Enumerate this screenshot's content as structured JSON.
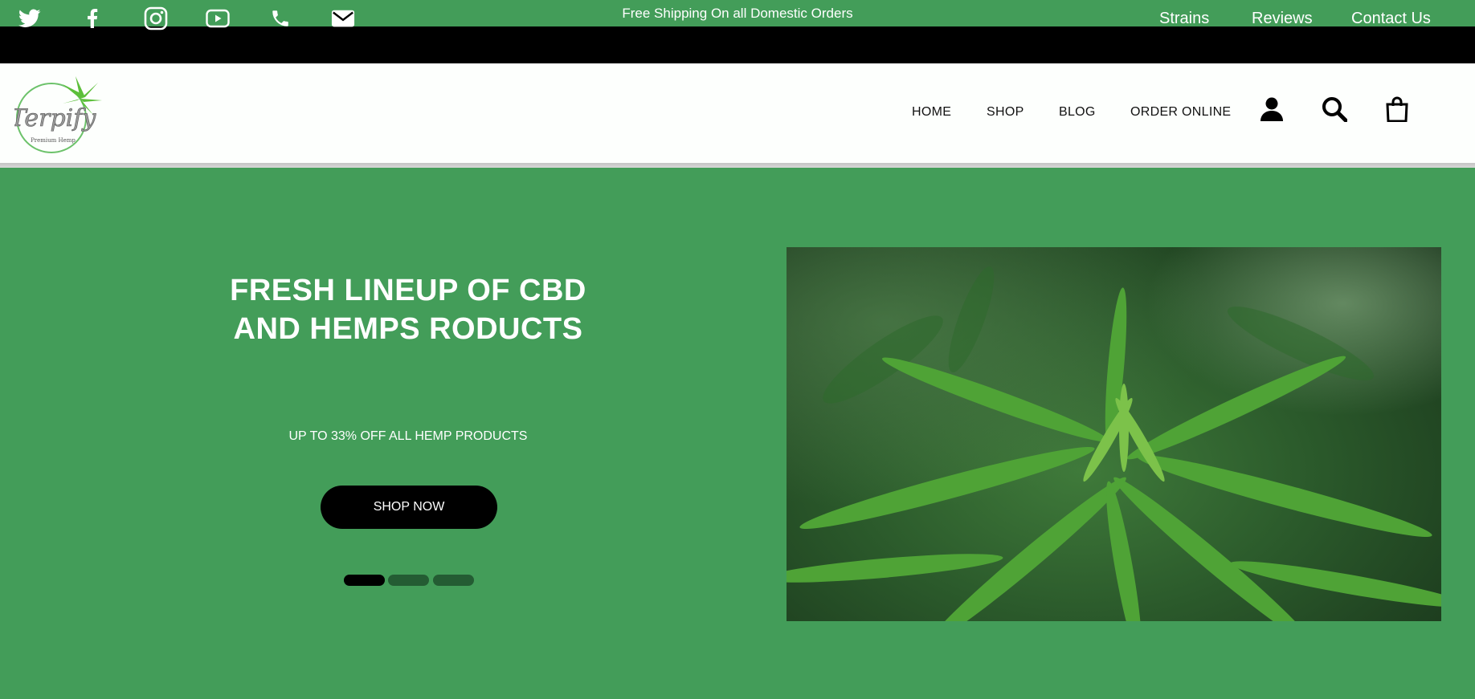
{
  "announcement": "Free Shipping On all Domestic Orders",
  "social_icons": [
    "twitter-icon",
    "facebook-icon",
    "instagram-icon",
    "youtube-icon",
    "phone-icon",
    "email-icon"
  ],
  "top_links": [
    "Strains",
    "Reviews",
    "Contact Us"
  ],
  "nav": {
    "home": "HOME",
    "shop": "SHOP",
    "blog": "BLOG",
    "order": "ORDER ONLINE"
  },
  "header_icons": [
    "user-icon",
    "search-icon",
    "shopping-bag-icon"
  ],
  "logo": {
    "text": "Terpify",
    "tagline": "Premium Hemp"
  },
  "hero": {
    "title": "FRESH LINEUP OF CBD AND HEMPS RODUCTS",
    "subtitle": "UP TO 33% OFF ALL HEMP PRODUCTS",
    "button": "SHOP NOW",
    "slides": 3,
    "active_slide": 1,
    "image": "cannabis-plant-photo"
  },
  "colors": {
    "brand_green": "#439d59",
    "dark_green_dot": "#245c33",
    "black": "#000000"
  }
}
